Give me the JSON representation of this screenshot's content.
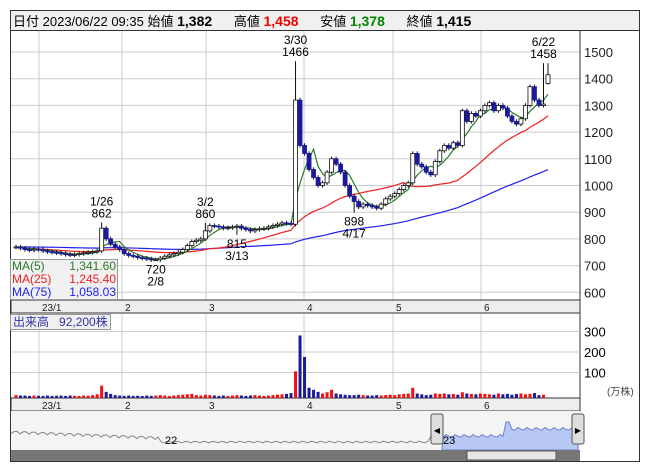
{
  "header": {
    "date_label": "日付",
    "datetime": "2023/06/22 09:35",
    "open_label": "始値",
    "open": "1,382",
    "high_label": "高値",
    "high": "1,458",
    "low_label": "安値",
    "low": "1,378",
    "close_label": "終値",
    "close": "1,415"
  },
  "ma_legend": [
    {
      "label": "MA(5)",
      "value": "1,341.60",
      "color": "#2a7a2a"
    },
    {
      "label": "MA(25)",
      "value": "1,245.40",
      "color": "#f02020"
    },
    {
      "label": "MA(75)",
      "value": "1,058.03",
      "color": "#2020f0"
    }
  ],
  "volume": {
    "label": "出来高",
    "value": "92,200株",
    "axis": [
      "300",
      "200",
      "100"
    ],
    "unit": "(万株)"
  },
  "navigator": {
    "labels": [
      "22",
      "23"
    ]
  },
  "chart_data": {
    "type": "candlestick",
    "y_ticks": [
      1500,
      1400,
      1300,
      1200,
      1100,
      1000,
      900,
      800,
      700,
      600
    ],
    "ylim": [
      600,
      1500
    ],
    "month_labels": [
      "23/1",
      "2",
      "3",
      "4",
      "5",
      "6"
    ],
    "month_start_index": [
      5,
      23,
      42,
      64,
      83,
      102
    ],
    "annotations": [
      {
        "date": "1/26",
        "value": "862",
        "idx": 19,
        "price": 862,
        "pos": "above"
      },
      {
        "date": "2/8",
        "value": "720",
        "idx": 31,
        "price": 720,
        "pos": "below"
      },
      {
        "date": "3/2",
        "value": "860",
        "idx": 42,
        "price": 860,
        "pos": "above"
      },
      {
        "date": "3/13",
        "value": "815",
        "idx": 49,
        "price": 815,
        "pos": "below"
      },
      {
        "date": "3/30",
        "value": "1466",
        "idx": 62,
        "price": 1466,
        "pos": "above"
      },
      {
        "date": "4/17",
        "value": "898",
        "idx": 75,
        "price": 898,
        "pos": "below"
      },
      {
        "date": "6/22",
        "value": "1458",
        "idx": 117,
        "price": 1458,
        "pos": "above"
      }
    ],
    "closes": [
      770,
      765,
      760,
      758,
      762,
      760,
      755,
      752,
      750,
      748,
      745,
      742,
      740,
      742,
      745,
      748,
      750,
      752,
      755,
      840,
      800,
      780,
      770,
      760,
      745,
      738,
      735,
      730,
      728,
      725,
      722,
      722,
      728,
      735,
      740,
      745,
      750,
      760,
      775,
      790,
      795,
      800,
      830,
      850,
      848,
      845,
      840,
      842,
      845,
      848,
      840,
      835,
      830,
      835,
      838,
      840,
      845,
      850,
      855,
      860,
      858,
      855,
      1320,
      1150,
      1120,
      1060,
      1030,
      1000,
      1010,
      1050,
      1100,
      1080,
      1050,
      1000,
      960,
      940,
      920,
      930,
      925,
      920,
      915,
      930,
      950,
      960,
      970,
      985,
      1000,
      1010,
      1120,
      1080,
      1070,
      1050,
      1040,
      1090,
      1130,
      1150,
      1140,
      1160,
      1150,
      1280,
      1240,
      1270,
      1260,
      1280,
      1300,
      1310,
      1280,
      1300,
      1290,
      1260,
      1240,
      1230,
      1250,
      1300,
      1370,
      1320,
      1300,
      1305,
      1415
    ],
    "volumes": [
      14,
      12,
      12,
      10,
      12,
      11,
      10,
      12,
      10,
      11,
      12,
      10,
      12,
      11,
      10,
      12,
      11,
      14,
      18,
      60,
      30,
      20,
      14,
      12,
      10,
      12,
      10,
      11,
      10,
      12,
      10,
      12,
      14,
      12,
      10,
      12,
      14,
      16,
      18,
      20,
      14,
      12,
      16,
      14,
      12,
      10,
      12,
      10,
      12,
      14,
      12,
      10,
      12,
      14,
      12,
      10,
      12,
      14,
      16,
      18,
      20,
      24,
      130,
      305,
      200,
      50,
      40,
      30,
      22,
      28,
      40,
      22,
      18,
      16,
      14,
      14,
      16,
      14,
      12,
      12,
      14,
      12,
      14,
      16,
      14,
      18,
      20,
      22,
      50,
      22,
      18,
      14,
      16,
      22,
      20,
      22,
      18,
      20,
      16,
      28,
      22,
      20,
      18,
      22,
      20,
      18,
      16,
      22,
      18,
      20,
      16,
      20,
      22,
      18,
      20,
      24,
      14,
      16
    ]
  }
}
